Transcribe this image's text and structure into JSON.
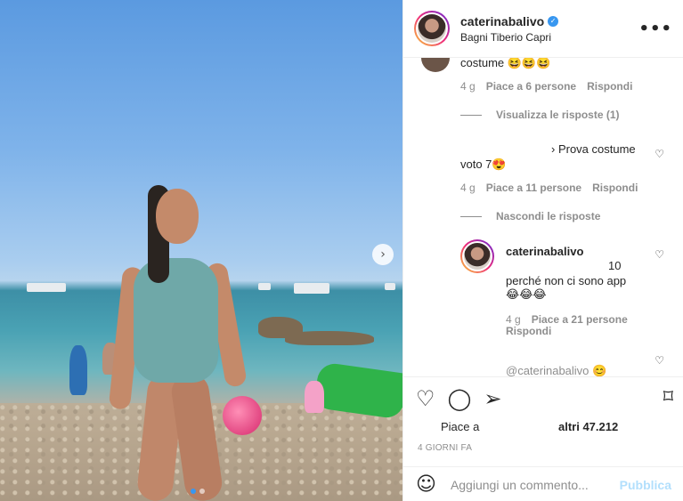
{
  "header": {
    "username": "caterinabalivo",
    "verified_mark": "✓",
    "location": "Bagni Tiberio Capri",
    "more_icon": "•••"
  },
  "comments": [
    {
      "text": "costume 😆😆😆",
      "meta": {
        "time": "4 g",
        "likes": "Piace a 6 persone",
        "reply": "Rispondi"
      },
      "replies_toggle": "Visualizza le risposte (1)"
    },
    {
      "text_line1": "› Prova costume",
      "text_line2": "voto 7😍",
      "meta": {
        "time": "4 g",
        "likes": "Piace a 11 persone",
        "reply": "Rispondi"
      },
      "replies_toggle": "Nascondi le risposte"
    }
  ],
  "reply": {
    "username": "caterinabalivo",
    "text_line1": "10",
    "text_line2": "perché non ci sono app",
    "text_line3": "😂😂😂",
    "meta": {
      "time": "4 g",
      "likes": "Piace a 21 persone",
      "reply": "Rispondi"
    }
  },
  "partial_comment": "@caterinabalivo 😊",
  "icons": {
    "heart": "♡",
    "comment": "◯",
    "share": "➢",
    "bookmark": "⌑",
    "smile": "☺",
    "carousel_next": "›"
  },
  "likes": {
    "prefix": "Piace a",
    "count": "altri 47.212"
  },
  "date": "4 GIORNI FA",
  "add_comment": {
    "placeholder": "Aggiungi un commento...",
    "publish": "Pubblica"
  },
  "colors": {
    "accent": "#3897f0",
    "publish_disabled": "#b2dffc",
    "secondary_text": "#8e8e8e"
  }
}
